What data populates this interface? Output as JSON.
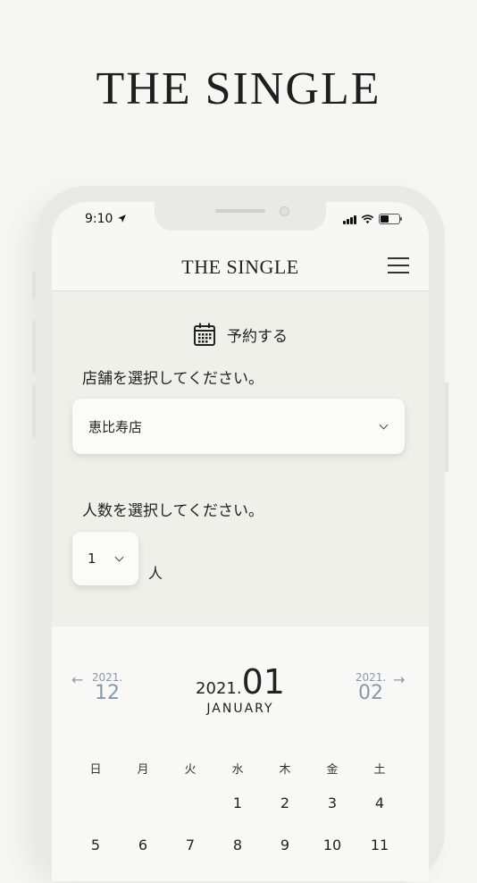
{
  "hero": {
    "title": "THE SINGLE"
  },
  "status": {
    "time": "9:10"
  },
  "header": {
    "logo": "THE SINGLE"
  },
  "reserve": {
    "title": "予約する",
    "store_label": "店舗を選択してください。",
    "store_value": "恵比寿店",
    "people_label": "人数を選択してください。",
    "people_value": "1",
    "people_unit": "人"
  },
  "calendar": {
    "prev": {
      "year": "2021.",
      "month": "12"
    },
    "current": {
      "year": "2021.",
      "month": "01",
      "name": "JANUARY"
    },
    "next": {
      "year": "2021.",
      "month": "02"
    },
    "weekdays": [
      "日",
      "月",
      "火",
      "水",
      "木",
      "金",
      "土"
    ],
    "row1": [
      "1",
      "2",
      "3",
      "4"
    ],
    "row2": [
      "5",
      "6",
      "7",
      "8",
      "9",
      "10",
      "11"
    ]
  },
  "icons": {
    "calendar": "calendar-icon",
    "menu": "hamburger-menu-icon",
    "location": "location-arrow-icon"
  }
}
